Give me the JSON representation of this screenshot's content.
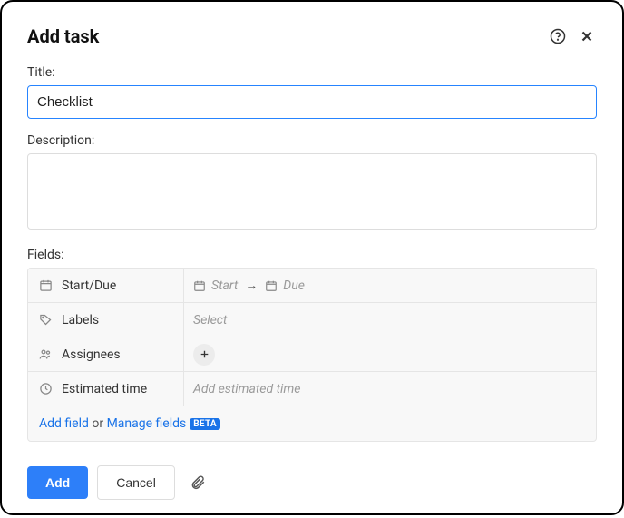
{
  "header": {
    "title": "Add task"
  },
  "form": {
    "title_label": "Title:",
    "title_value": "Checklist",
    "description_label": "Description:",
    "description_value": ""
  },
  "fields": {
    "section_label": "Fields:",
    "start_due": {
      "label": "Start/Due",
      "start_placeholder": "Start",
      "due_placeholder": "Due"
    },
    "labels": {
      "label": "Labels",
      "placeholder": "Select"
    },
    "assignees": {
      "label": "Assignees"
    },
    "estimated_time": {
      "label": "Estimated time",
      "placeholder": "Add estimated time"
    },
    "add_field": {
      "add_link": "Add field",
      "or_text": " or ",
      "manage_link": "Manage fields",
      "beta": "BETA"
    }
  },
  "footer": {
    "add": "Add",
    "cancel": "Cancel"
  }
}
